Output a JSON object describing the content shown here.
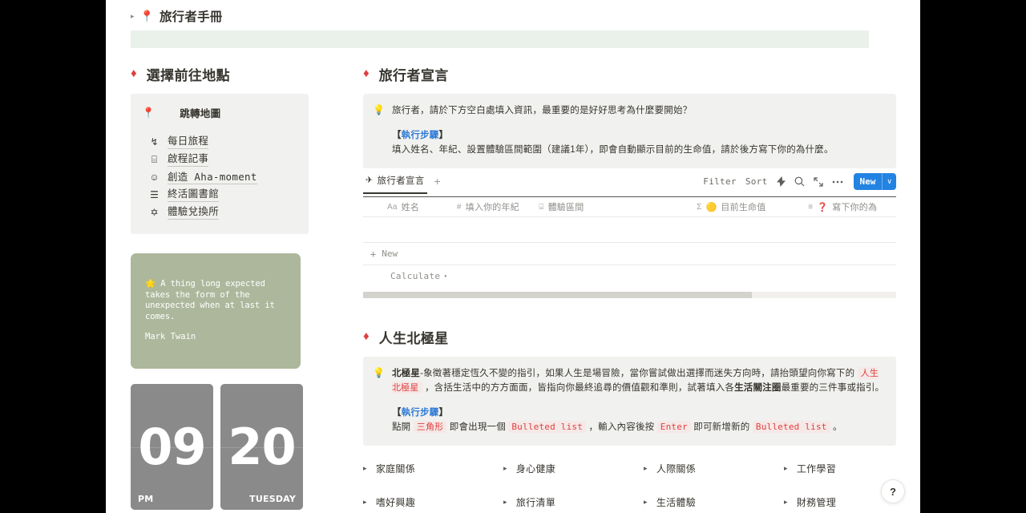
{
  "breadcrumb": {
    "arrow": "▸",
    "emoji": "📍",
    "title": "旅行者手冊"
  },
  "sidebar": {
    "heading": "選擇前往地點",
    "diamond": "♦",
    "map_link": {
      "icon": "📍",
      "label": "跳轉地圖"
    },
    "items": [
      {
        "icon": "↯",
        "label": "每日旅程"
      },
      {
        "icon": "⌸",
        "label": "啟程記事"
      },
      {
        "icon": "☺",
        "label": "創造 Aha-moment"
      },
      {
        "icon": "☰",
        "label": "終活圖書館"
      },
      {
        "icon": "✡",
        "label": "體驗兌換所"
      }
    ],
    "quote": {
      "star": "🌟",
      "text": "A thing long expected takes the form of the unexpected when at last it comes.",
      "author": "Mark Twain"
    },
    "clock": {
      "hour": "09",
      "meridiem": "PM",
      "day": "20",
      "weekday": "TUESDAY"
    }
  },
  "declaration": {
    "diamond": "♦",
    "heading": "旅行者宣言",
    "callout": {
      "bulb": "💡",
      "intro": "旅行者，請於下方空白處填入資訊，最重要的是好好思考為什麼要開始？",
      "steps_open": "【",
      "steps_label": "執行步驟",
      "steps_close": "】",
      "steps_body": "填入姓名、年紀、設置體驗區間範圍（建議1年），即會自動顯示目前的生命值，請於後方寫下你的為什麼。"
    },
    "database": {
      "tab": {
        "icon": "✈",
        "label": "旅行者宣言"
      },
      "add_tab": "+",
      "tools": {
        "filter": "Filter",
        "sort": "Sort",
        "lightning_icon": "lightning-icon",
        "search_icon": "search-icon",
        "expand_icon": "expand-icon",
        "more_icon": "more-icon",
        "new_label": "New",
        "new_chevron": "∨"
      },
      "columns": [
        {
          "icon": "Aa",
          "label": "姓名"
        },
        {
          "icon": "#",
          "label": "填入你的年紀"
        },
        {
          "icon": "⌸",
          "label": "體驗區間"
        },
        {
          "icon": "Σ",
          "emoji": "🟡",
          "label": "目前生命值"
        },
        {
          "icon": "≡",
          "emoji": "❓",
          "label": "寫下你的為"
        }
      ],
      "new_row_label": "New",
      "calculate_label": "Calculate"
    }
  },
  "polestar": {
    "diamond": "♦",
    "heading": "人生北極星",
    "callout": {
      "bulb": "💡",
      "term": "北極星",
      "line1_a": "-象徵著穩定恆久不變的指引，如果人生是場冒險，當你嘗試做出選擇而迷失方向時，請抬頭望向你寫下的 ",
      "code1": "人生北極星",
      "line1_b": " ，含括生活中的方方面面，皆指向你最終追尋的價值觀和準則，試著填入各",
      "line1_bold": "生活關注圈",
      "line1_c": "最重要的三件事或指引。",
      "steps_open": "【",
      "steps_label": "執行步驟",
      "steps_close": "】",
      "steps_a": "點開 ",
      "steps_code1": "三角形",
      "steps_b": " 即會出現一個 ",
      "steps_code2": "Bulleted list",
      "steps_c": " ，輸入內容後按 ",
      "steps_code3": "Enter",
      "steps_d": " 即可新增新的 ",
      "steps_code4": "Bulleted list",
      "steps_e": " 。"
    },
    "toggles": [
      {
        "tri": "▸",
        "label": "家庭關係"
      },
      {
        "tri": "▸",
        "label": "身心健康"
      },
      {
        "tri": "▸",
        "label": "人際關係"
      },
      {
        "tri": "▸",
        "label": "工作學習"
      },
      {
        "tri": "▸",
        "label": "嗜好興趣"
      },
      {
        "tri": "▸",
        "label": "旅行清單"
      },
      {
        "tri": "▸",
        "label": "生活體驗"
      },
      {
        "tri": "▸",
        "label": "財務管理"
      }
    ]
  },
  "help_button": {
    "label": "?"
  },
  "colors": {
    "accent_red": "#e03e3e",
    "accent_blue": "#2383e2",
    "mint_band": "#eaf0ea",
    "sage_card": "#adb79c",
    "clock_gray": "#8a8a8a",
    "callout_bg": "#f1f1ef"
  }
}
